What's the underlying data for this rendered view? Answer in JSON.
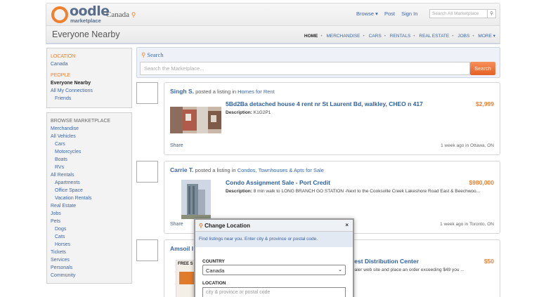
{
  "header": {
    "logo_word": "oodle",
    "logo_sub": "marketplace",
    "region": "Canada",
    "links": [
      "Browse ▾",
      "Post",
      "Sign In"
    ],
    "search_placeholder": "Search All Marketplace"
  },
  "subheader": {
    "title": "Everyone Nearby",
    "nav": [
      "HOME",
      "MERCHANDISE",
      "CARS",
      "RENTALS",
      "REAL ESTATE",
      "JOBS",
      "MORE ▾"
    ]
  },
  "sidebar": {
    "location_head": "LOCATION",
    "location_value": "Canada",
    "people_head": "PEOPLE",
    "people": [
      "Everyone Nearby",
      "All My Connections",
      "Friends"
    ],
    "browse_head": "BROWSE MARKETPLACE",
    "browse": [
      {
        "label": "Merchandise",
        "indent": false
      },
      {
        "label": "All Vehicles",
        "indent": false
      },
      {
        "label": "Cars",
        "indent": true
      },
      {
        "label": "Motorcycles",
        "indent": true
      },
      {
        "label": "Boats",
        "indent": true
      },
      {
        "label": "RVs",
        "indent": true
      },
      {
        "label": "All Rentals",
        "indent": false
      },
      {
        "label": "Apartments",
        "indent": true
      },
      {
        "label": "Office Space",
        "indent": true
      },
      {
        "label": "Vacation Rentals",
        "indent": true
      },
      {
        "label": "Real Estate",
        "indent": false
      },
      {
        "label": "Jobs",
        "indent": false
      },
      {
        "label": "Pets",
        "indent": false
      },
      {
        "label": "Dogs",
        "indent": true
      },
      {
        "label": "Cats",
        "indent": true
      },
      {
        "label": "Horses",
        "indent": true
      },
      {
        "label": "Tickets",
        "indent": false
      },
      {
        "label": "Services",
        "indent": false
      },
      {
        "label": "Personals",
        "indent": false
      },
      {
        "label": "Community",
        "indent": false
      }
    ]
  },
  "search": {
    "label": "Search",
    "placeholder": "Search the Marketplace...",
    "button": "Search"
  },
  "listings": [
    {
      "user": "Singh S.",
      "action": "posted a listing in",
      "category": "Homes for Rent",
      "title": "5Bd2Ba detached house 4 rent nr St Laurent Bd, walkley, CHEO n 417",
      "price": "$2,999",
      "desc_label": "Description:",
      "desc": "K1G2P1",
      "share": "Share",
      "meta": "1 week ago in Ottawa, ON"
    },
    {
      "user": "Carrie T.",
      "action": "posted a listing in",
      "category": "Condos, Townhouses & Apts for Sale",
      "title": "Condo Assignment Sale - Port Credit",
      "price": "$980,000",
      "desc_label": "Description:",
      "desc": "8 min walk to LONG BRANCH GO STATION -Next to the Cooksville Creek Lakeshore Road East & Beechwoo...",
      "share": "Share",
      "meta": "1 week ago in Toronto, ON"
    },
    {
      "user": "Amsoil I",
      "title": "rest Distribution Center",
      "price": "$50",
      "desc": "ealer web site and place an order exceeding $49 you ...",
      "photo_text": "FREE S"
    }
  ],
  "modal": {
    "title": "Change Location",
    "close": "×",
    "info": "Find listings near you. Enter city & province or postal code.",
    "country_label": "COUNTRY",
    "country_value": "Canada",
    "location_label": "LOCATION",
    "location_placeholder": "city & province or postal code"
  },
  "colors": {
    "accent": "#f07f2e",
    "link": "#3a66a8",
    "title_link": "#2f5f9e"
  }
}
